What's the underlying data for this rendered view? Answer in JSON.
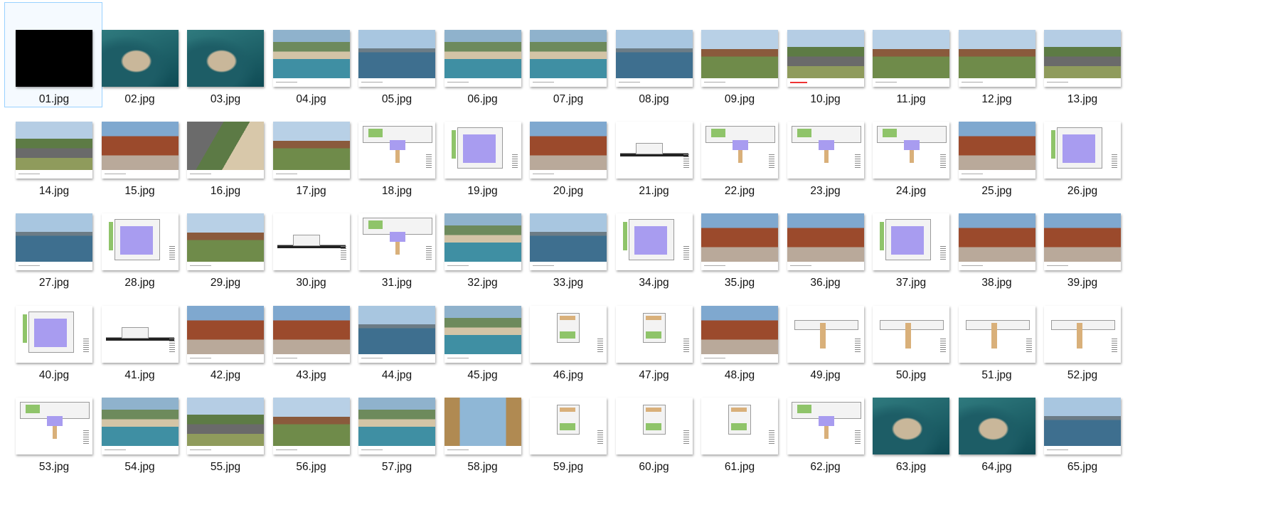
{
  "window": {
    "selected_file": "01.jpg"
  },
  "files": [
    {
      "name": "01.jpg",
      "kind": "black"
    },
    {
      "name": "02.jpg",
      "kind": "aerial"
    },
    {
      "name": "03.jpg",
      "kind": "aerial"
    },
    {
      "name": "04.jpg",
      "kind": "coast"
    },
    {
      "name": "05.jpg",
      "kind": "sea"
    },
    {
      "name": "06.jpg",
      "kind": "coast"
    },
    {
      "name": "07.jpg",
      "kind": "coast"
    },
    {
      "name": "08.jpg",
      "kind": "sea"
    },
    {
      "name": "09.jpg",
      "kind": "land"
    },
    {
      "name": "10.jpg",
      "kind": "road",
      "red_caption": true
    },
    {
      "name": "11.jpg",
      "kind": "land"
    },
    {
      "name": "12.jpg",
      "kind": "land"
    },
    {
      "name": "13.jpg",
      "kind": "road"
    },
    {
      "name": "14.jpg",
      "kind": "road"
    },
    {
      "name": "15.jpg",
      "kind": "brick"
    },
    {
      "name": "16.jpg",
      "kind": "slope"
    },
    {
      "name": "17.jpg",
      "kind": "land"
    },
    {
      "name": "18.jpg",
      "kind": "site"
    },
    {
      "name": "19.jpg",
      "kind": "plan"
    },
    {
      "name": "20.jpg",
      "kind": "brick"
    },
    {
      "name": "21.jpg",
      "kind": "section"
    },
    {
      "name": "22.jpg",
      "kind": "site"
    },
    {
      "name": "23.jpg",
      "kind": "site"
    },
    {
      "name": "24.jpg",
      "kind": "site"
    },
    {
      "name": "25.jpg",
      "kind": "brick"
    },
    {
      "name": "26.jpg",
      "kind": "plan"
    },
    {
      "name": "27.jpg",
      "kind": "sea"
    },
    {
      "name": "28.jpg",
      "kind": "plan"
    },
    {
      "name": "29.jpg",
      "kind": "land"
    },
    {
      "name": "30.jpg",
      "kind": "section"
    },
    {
      "name": "31.jpg",
      "kind": "site"
    },
    {
      "name": "32.jpg",
      "kind": "coast"
    },
    {
      "name": "33.jpg",
      "kind": "sea"
    },
    {
      "name": "34.jpg",
      "kind": "plan"
    },
    {
      "name": "35.jpg",
      "kind": "brick"
    },
    {
      "name": "36.jpg",
      "kind": "brick"
    },
    {
      "name": "37.jpg",
      "kind": "plan"
    },
    {
      "name": "38.jpg",
      "kind": "brick"
    },
    {
      "name": "39.jpg",
      "kind": "brick"
    },
    {
      "name": "40.jpg",
      "kind": "plan"
    },
    {
      "name": "41.jpg",
      "kind": "section"
    },
    {
      "name": "42.jpg",
      "kind": "brick"
    },
    {
      "name": "43.jpg",
      "kind": "brick"
    },
    {
      "name": "44.jpg",
      "kind": "sea"
    },
    {
      "name": "45.jpg",
      "kind": "coast"
    },
    {
      "name": "46.jpg",
      "kind": "unit"
    },
    {
      "name": "47.jpg",
      "kind": "unit"
    },
    {
      "name": "48.jpg",
      "kind": "brick"
    },
    {
      "name": "49.jpg",
      "kind": "tplan"
    },
    {
      "name": "50.jpg",
      "kind": "tplan"
    },
    {
      "name": "51.jpg",
      "kind": "tplan"
    },
    {
      "name": "52.jpg",
      "kind": "tplan"
    },
    {
      "name": "53.jpg",
      "kind": "site"
    },
    {
      "name": "54.jpg",
      "kind": "coast"
    },
    {
      "name": "55.jpg",
      "kind": "road"
    },
    {
      "name": "56.jpg",
      "kind": "land"
    },
    {
      "name": "57.jpg",
      "kind": "coast"
    },
    {
      "name": "58.jpg",
      "kind": "interior"
    },
    {
      "name": "59.jpg",
      "kind": "unit"
    },
    {
      "name": "60.jpg",
      "kind": "unit"
    },
    {
      "name": "61.jpg",
      "kind": "unit"
    },
    {
      "name": "62.jpg",
      "kind": "site"
    },
    {
      "name": "63.jpg",
      "kind": "aerial"
    },
    {
      "name": "64.jpg",
      "kind": "aerial"
    },
    {
      "name": "65.jpg",
      "kind": "sea"
    }
  ]
}
